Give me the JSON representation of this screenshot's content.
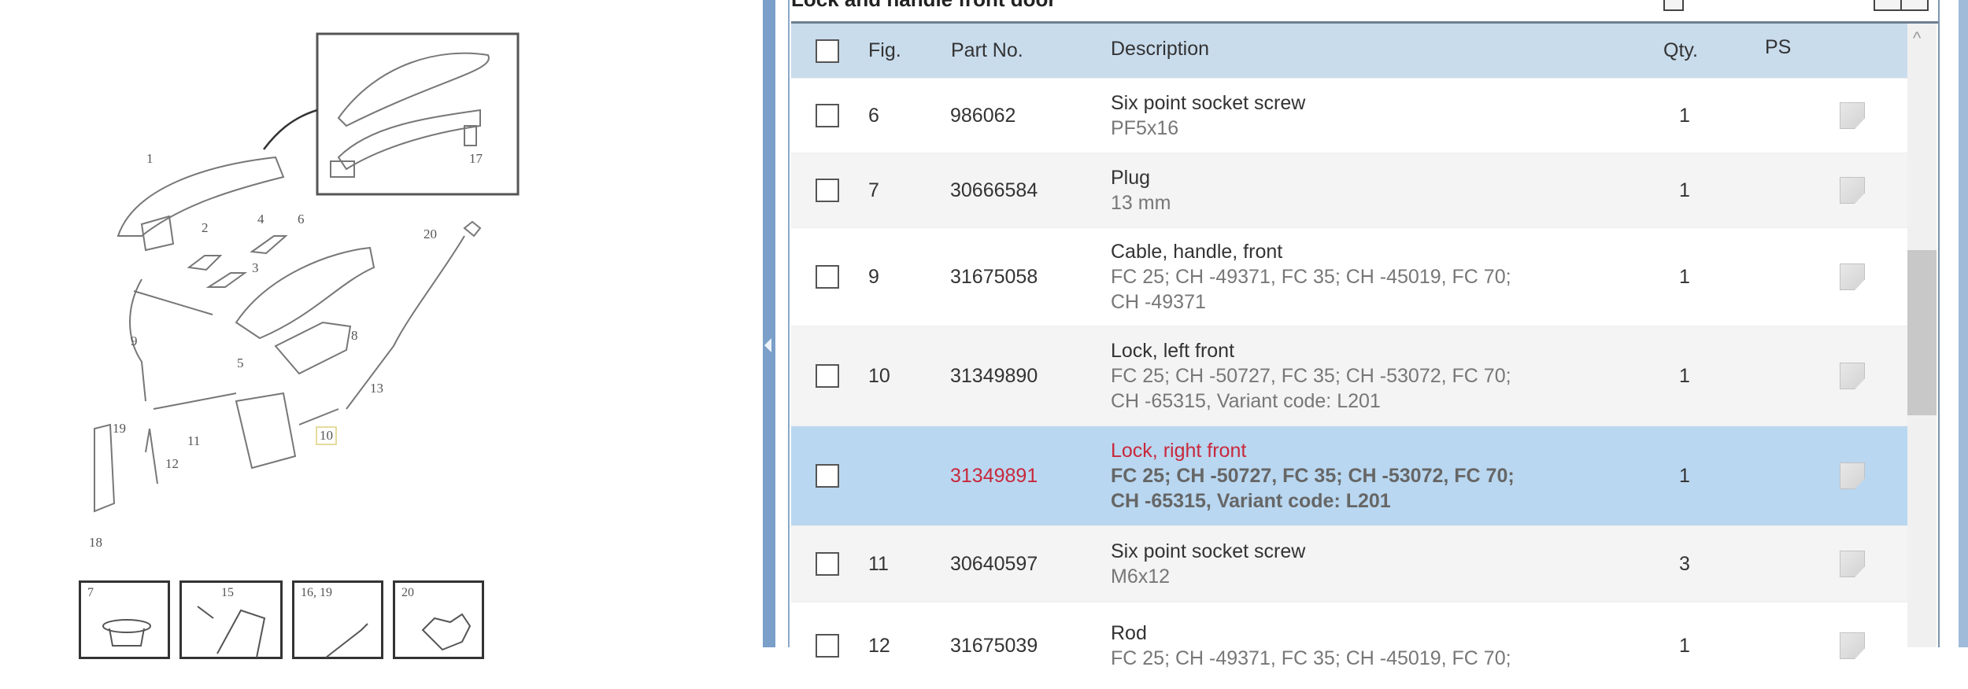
{
  "diagram": {
    "labels": [
      "1",
      "2",
      "3",
      "4",
      "5",
      "6",
      "8",
      "9",
      "10",
      "11",
      "12",
      "13",
      "17",
      "18",
      "19",
      "20"
    ],
    "thumbnails": [
      "7",
      "15",
      "16, 19",
      "20"
    ]
  },
  "panel": {
    "title": "Lock and handle front door"
  },
  "table": {
    "headers": {
      "fig": "Fig.",
      "part": "Part No.",
      "description": "Description",
      "qty": "Qty.",
      "ps": "PS"
    },
    "rows": [
      {
        "fig": "6",
        "part": "986062",
        "name": "Six point socket screw",
        "details": [
          "PF5x16"
        ],
        "qty": "1",
        "selected": false
      },
      {
        "fig": "7",
        "part": "30666584",
        "name": "Plug",
        "details": [
          "13 mm"
        ],
        "qty": "1",
        "selected": false
      },
      {
        "fig": "9",
        "part": "31675058",
        "name": "Cable, handle, front",
        "details": [
          "FC 25; CH -49371, FC 35; CH -45019, FC 70;",
          "CH -49371"
        ],
        "qty": "1",
        "selected": false
      },
      {
        "fig": "10",
        "part": "31349890",
        "name": "Lock, left front",
        "details": [
          "FC 25; CH -50727, FC 35; CH -53072, FC 70;",
          "CH -65315, Variant code: L201"
        ],
        "qty": "1",
        "selected": false
      },
      {
        "fig": "",
        "part": "31349891",
        "name": "Lock, right front",
        "details": [
          "FC 25; CH -50727, FC 35; CH -53072, FC 70;",
          "CH -65315, Variant code: L201"
        ],
        "qty": "1",
        "selected": true
      },
      {
        "fig": "11",
        "part": "30640597",
        "name": "Six point socket screw",
        "details": [
          "M6x12"
        ],
        "qty": "3",
        "selected": false
      },
      {
        "fig": "12",
        "part": "31675039",
        "name": "Rod",
        "details": [
          "FC 25; CH -49371, FC 35; CH -45019, FC 70;"
        ],
        "qty": "1",
        "selected": false
      }
    ]
  },
  "colors": {
    "header_bg": "#c9dcec",
    "selected_bg": "#b9d7f0",
    "selected_text": "#c8283c"
  }
}
